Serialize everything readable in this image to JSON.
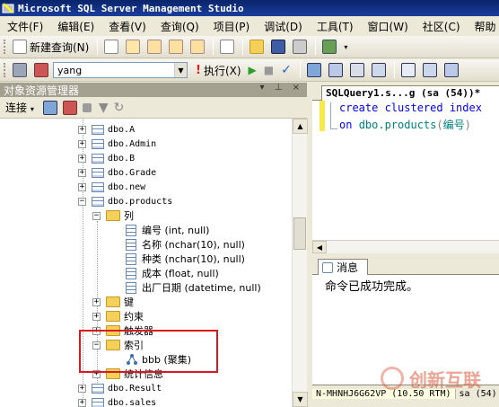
{
  "window": {
    "title": "Microsoft SQL Server Management Studio"
  },
  "menu": [
    "文件(F)",
    "编辑(E)",
    "查看(V)",
    "查询(Q)",
    "项目(P)",
    "调试(D)",
    "工具(T)",
    "窗口(W)",
    "社区(C)",
    "帮助"
  ],
  "toolbar1": {
    "new_query_label": "新建查询(N)"
  },
  "toolbar2": {
    "database": "yang",
    "execute_label": "执行(X)"
  },
  "object_explorer": {
    "title": "对象资源管理器",
    "pin_controls": "▾ ⊥ ×",
    "connect_label": "连接",
    "tables": [
      "dbo.A",
      "dbo.Admin",
      "dbo.B",
      "dbo.Grade",
      "dbo.new",
      "dbo.products"
    ],
    "columns_folder": "列",
    "columns": [
      "编号 (int, null)",
      "名称 (nchar(10), null)",
      "种类 (nchar(10), null)",
      "成本 (float, null)",
      "出厂日期 (datetime, null)"
    ],
    "folders": [
      "键",
      "约束",
      "触发器",
      "索引"
    ],
    "index_item": "bbb (聚集)",
    "stats_folder": "统计信息",
    "tables_after": [
      "dbo.Result",
      "dbo.sales"
    ]
  },
  "editor": {
    "tab_title": "SQLQuery1.s...g (sa (54))*",
    "line1": {
      "kw": "create clustered index",
      "rest": ""
    },
    "line2": {
      "kw": "on",
      "obj": "dbo.products",
      "paren_open": "(",
      "col": "编号",
      "paren_close": ")"
    }
  },
  "messages": {
    "tab_label": "消息",
    "text": "命令已成功完成。"
  },
  "statusbar": {
    "server": "N-MHNHJ6G62VP (10.50 RTM)",
    "user": "sa (54)"
  },
  "watermark": {
    "text": "创新互联"
  },
  "colors": {
    "highlight_box": "#d9191f",
    "keyword": "#0000ff",
    "object": "#008080"
  }
}
